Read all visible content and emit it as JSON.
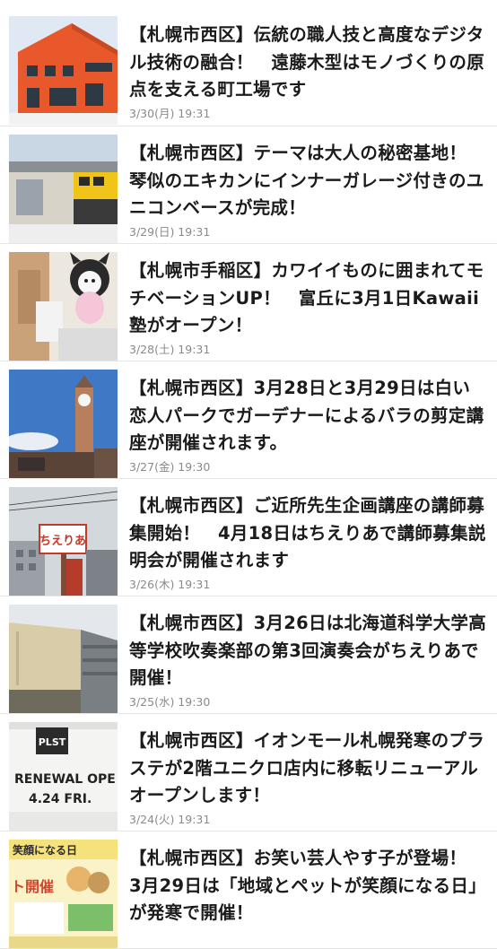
{
  "articles": [
    {
      "title": "【札幌市西区】伝統の職人技と高度なデジタル技術の融合！　遠藤木型はモノづくりの原点を支える町工場です",
      "date": "3/30(月) 19:31",
      "thumb": "orange-factory-building"
    },
    {
      "title": "【札幌市西区】テーマは大人の秘密基地！　琴似のエキカンにインナーガレージ付きのユニコンベースが完成！",
      "date": "3/29(日) 19:31",
      "thumb": "garage-building"
    },
    {
      "title": "【札幌市手稲区】カワイイものに囲まれてモチベーションUP！　富丘に3月1日Kawaii塾がオープン！",
      "date": "3/28(土) 19:31",
      "thumb": "kuromi-plush-room"
    },
    {
      "title": "【札幌市西区】3月28日と3月29日は白い恋人パークでガーデナーによるバラの剪定講座が開催されます。",
      "date": "3/27(金) 19:30",
      "thumb": "clock-tower"
    },
    {
      "title": "【札幌市西区】ご近所先生企画講座の講師募集開始！　4月18日はちえりあで講師募集説明会が開催されます",
      "date": "3/26(木) 19:31",
      "thumb": "chieria-sign",
      "thumb_text": "ちえりあ"
    },
    {
      "title": "【札幌市西区】3月26日は北海道科学大学高等学校吹奏楽部の第3回演奏会がちえりあで開催！",
      "date": "3/25(水) 19:30",
      "thumb": "concert-hall-building"
    },
    {
      "title": "【札幌市西区】イオンモール札幌発寒のプラステが2階ユニクロ店内に移転リニューアルオープンします！",
      "date": "3/24(火) 19:31",
      "thumb": "plst-renewal-sign",
      "thumb_text": {
        "brand": "PLST",
        "line1": "RENEWAL OPE",
        "line2": "4.24 FRI."
      }
    },
    {
      "title": "【札幌市西区】お笑い芸人やす子が登場！　3月29日は「地域とペットが笑顔になる日」が発寒で開催！",
      "date": "",
      "thumb": "pet-event-poster",
      "thumb_text": {
        "line1": "笑顔になる日",
        "line2": "ト開催"
      }
    }
  ]
}
